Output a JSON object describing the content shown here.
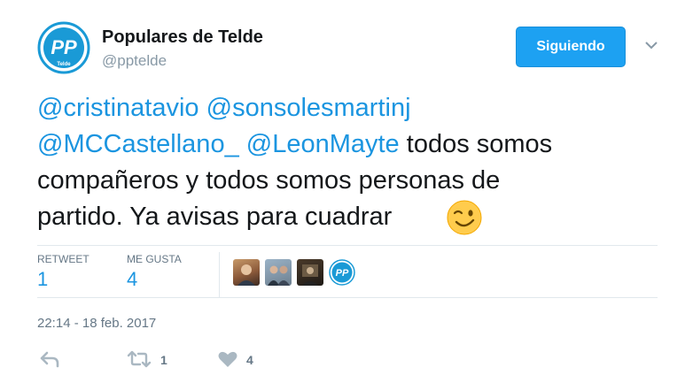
{
  "author": {
    "name": "Populares de Telde",
    "handle": "@pptelde",
    "logo_text": "PP",
    "logo_subtext": "Telde"
  },
  "follow_button": {
    "label": "Siguiendo"
  },
  "tweet": {
    "mentions": [
      "@cristinatavio",
      "@sonsolesmartinj",
      "@MCCastellano_",
      "@LeonMayte"
    ],
    "text_line2_rest": "todos somos",
    "text_line3": "compañeros y todos somos personas de",
    "text_line4": "partido. Ya avisas para cuadrar",
    "emoji": "winking-face"
  },
  "stats": {
    "retweets_label": "RETWEET",
    "retweets_value": "1",
    "likes_label": "ME GUSTA",
    "likes_value": "4"
  },
  "timestamp": "22:14 - 18 feb. 2017",
  "actions": {
    "retweet_count": "1",
    "like_count": "4"
  },
  "colors": {
    "accent": "#1da1f2",
    "mention": "#1b95e0",
    "muted": "#657786",
    "logo": "#1a9ad6"
  }
}
